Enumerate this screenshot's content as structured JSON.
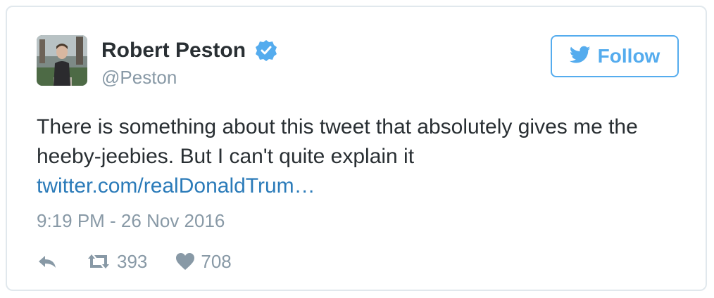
{
  "tweet": {
    "author": {
      "name": "Robert Peston",
      "handle": "@Peston",
      "verified": true,
      "avatar_icon": "profile-photo"
    },
    "follow_label": "Follow",
    "text_line1": "There is something about this tweet that absolutely gives me the",
    "text_line2": "heeby-jeebies. But I can't quite explain it",
    "link_text": "twitter.com/realDonaldTrum…",
    "timestamp": "9:19 PM - 26 Nov 2016",
    "retweet_count": "393",
    "like_count": "708"
  },
  "icons": {
    "verified": "verified-badge-icon",
    "follow": "twitter-bird-icon",
    "reply": "reply-icon",
    "retweet": "retweet-icon",
    "like": "heart-icon"
  },
  "colors": {
    "brand_blue": "#55acee",
    "link_blue": "#2b7bb9",
    "text": "#292f33",
    "muted": "#8899a6",
    "border": "#e1e8ed"
  }
}
